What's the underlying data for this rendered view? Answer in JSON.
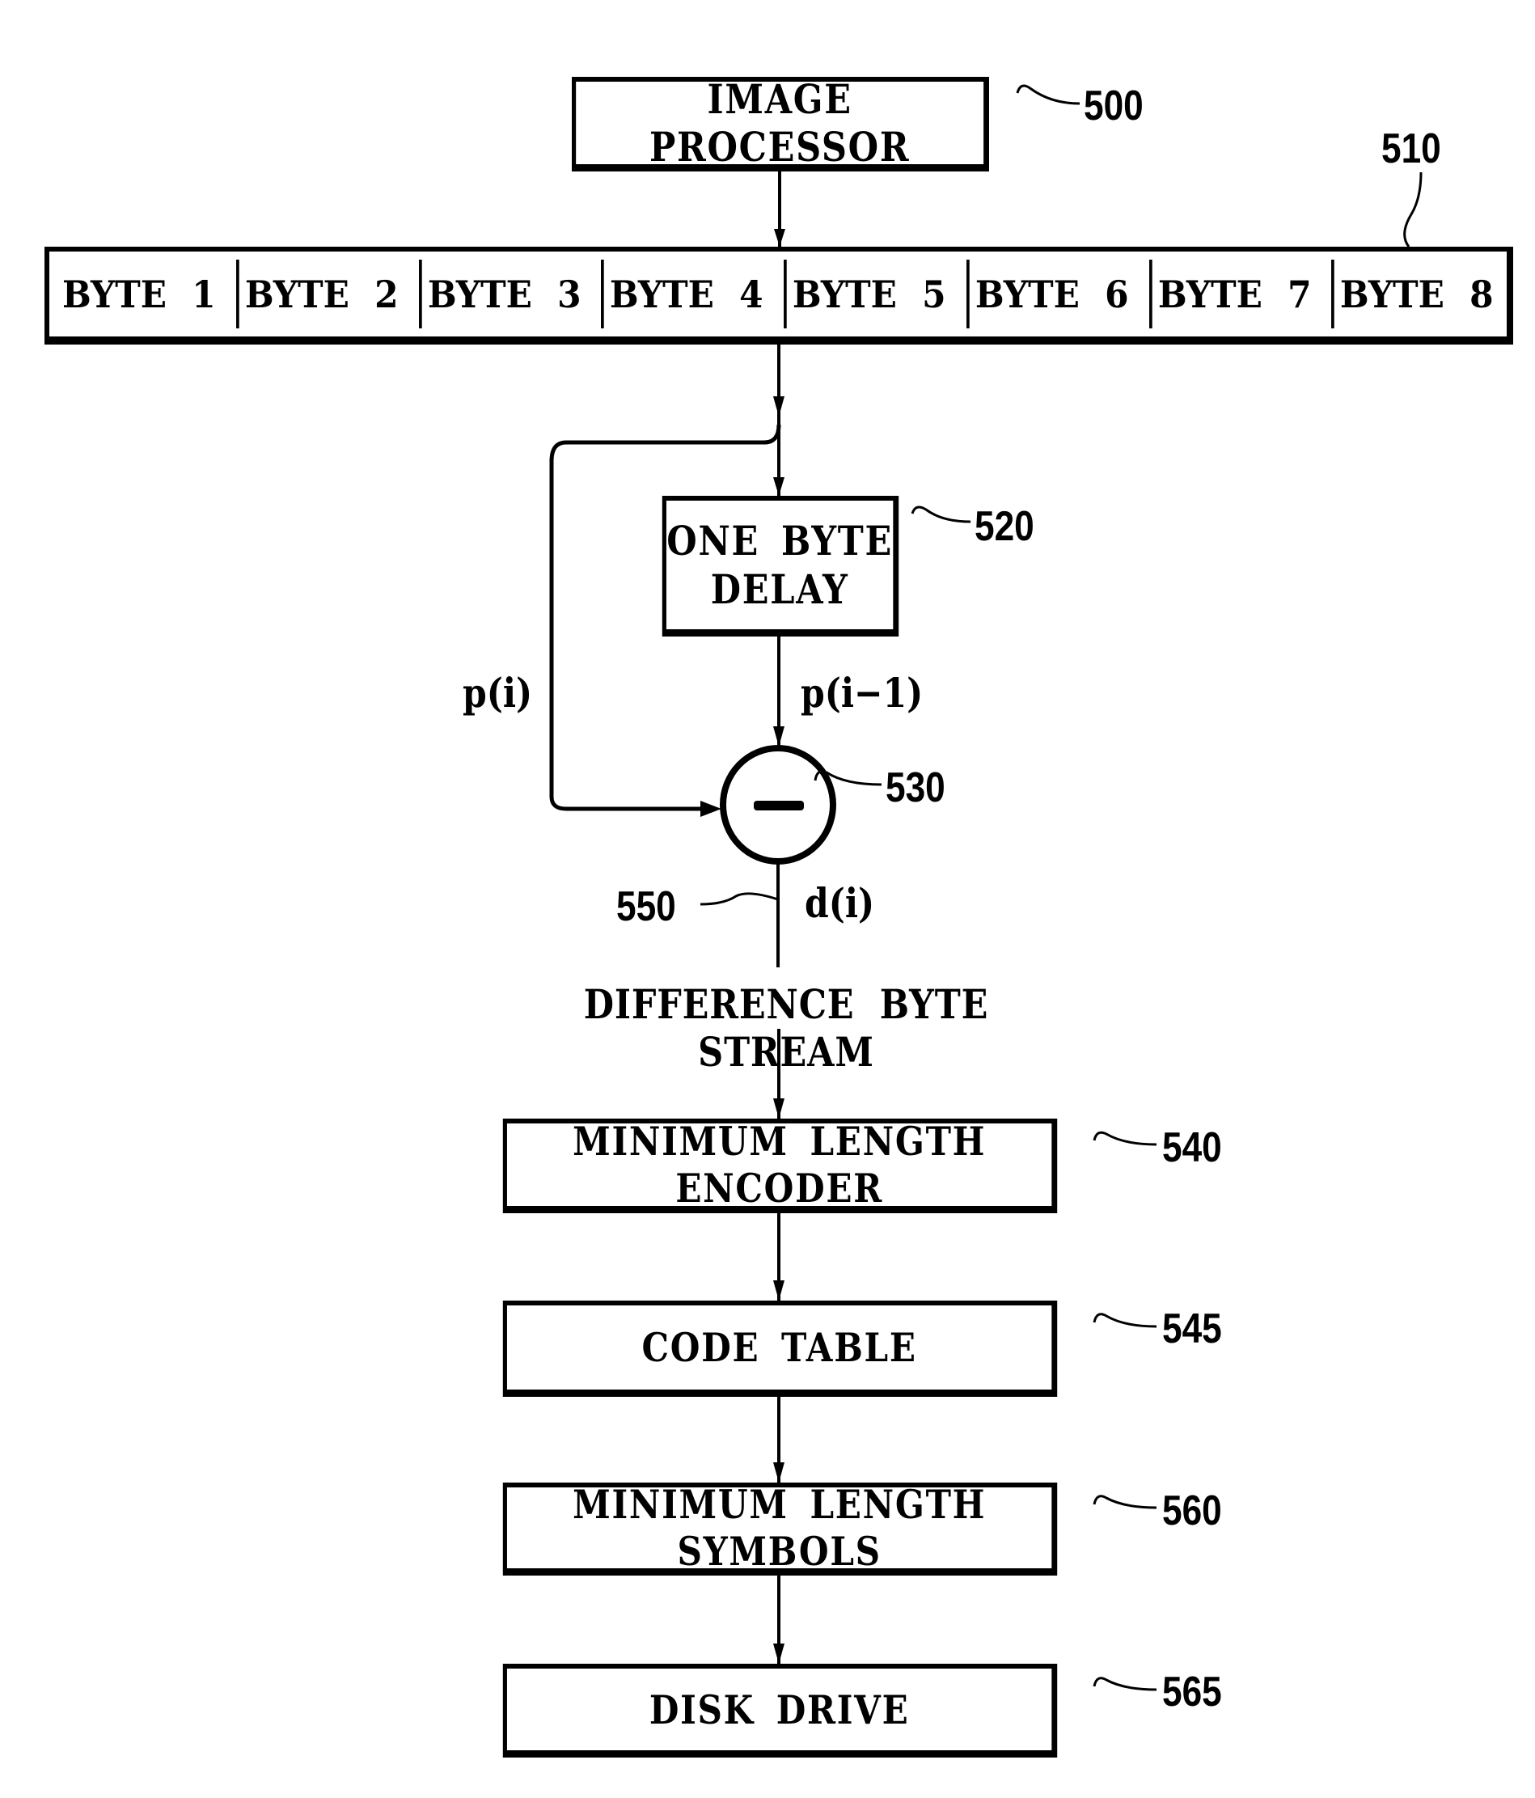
{
  "figure": {
    "blocks": {
      "image_processor": {
        "label": "IMAGE PROCESSOR",
        "ref": "500"
      },
      "byte_buffer": {
        "ref": "510",
        "cells": [
          "BYTE 1",
          "BYTE 2",
          "BYTE 3",
          "BYTE 4",
          "BYTE 5",
          "BYTE 6",
          "BYTE 7",
          "BYTE 8"
        ]
      },
      "one_byte_delay": {
        "label_line1": "ONE BYTE",
        "label_line2": "DELAY",
        "ref": "520"
      },
      "subtractor": {
        "symbol": "−",
        "ref": "530"
      },
      "min_length_encoder": {
        "label": "MINIMUM LENGTH ENCODER",
        "ref": "540"
      },
      "code_table": {
        "label": "CODE TABLE",
        "ref": "545"
      },
      "min_length_symbols": {
        "label": "MINIMUM LENGTH SYMBOLS",
        "ref": "560"
      },
      "disk_drive": {
        "label": "DISK DRIVE",
        "ref": "565"
      }
    },
    "signals": {
      "p_i": "p(i)",
      "p_i_minus_1": "p(i−1)",
      "d_i": "d(i)",
      "stream_ref": "550",
      "stream_label": "DIFFERENCE BYTE STREAM"
    }
  }
}
